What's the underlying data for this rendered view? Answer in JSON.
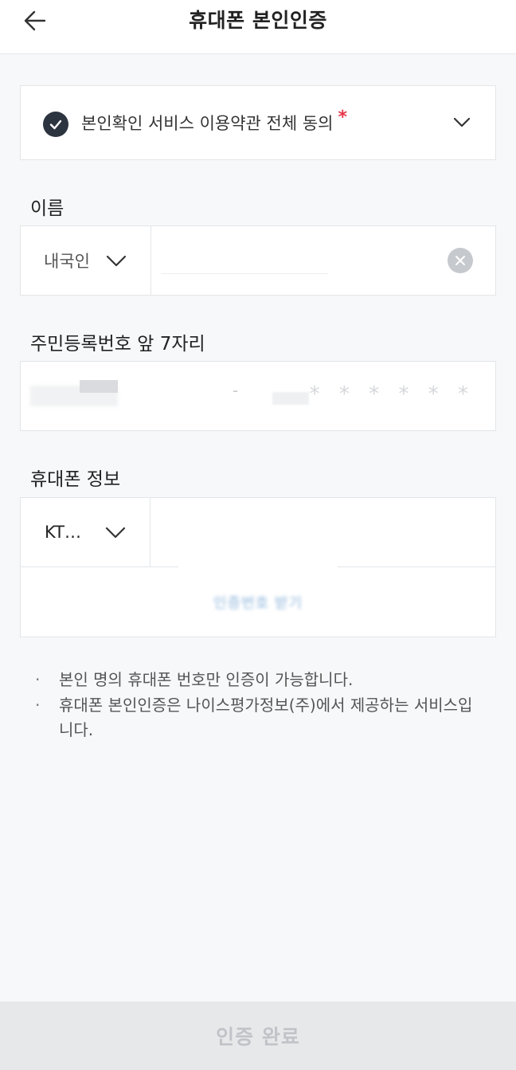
{
  "header": {
    "title": "휴대폰 본인인증",
    "back_icon": "arrow-left-icon"
  },
  "agreement": {
    "label": "본인확인 서비스 이용약관 전체 동의",
    "required_mark": "*",
    "checked": true,
    "colors": {
      "check_bg": "#2c3440",
      "required": "#e8364a"
    }
  },
  "name_section": {
    "label": "이름",
    "nationality_value": "내국인",
    "name_value": ""
  },
  "rrn_section": {
    "label": "주민등록번호 앞 7자리",
    "separator": "-",
    "masked_back": "* * * * * *"
  },
  "phone_section": {
    "label": "휴대폰 정보",
    "carrier_value": "KT…",
    "send_code_label": "인증번호 받기"
  },
  "notices": [
    "본인 명의 휴대폰 번호만 인증이 가능합니다.",
    "휴대폰 본인인증은 나이스평가정보(주)에서 제공하는 서비스입니다."
  ],
  "notice_bullet": "·",
  "footer": {
    "submit_label": "인증 완료"
  }
}
